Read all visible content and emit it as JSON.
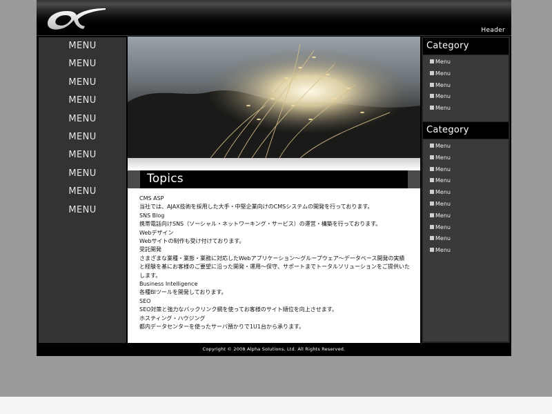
{
  "header": {
    "label": "Header"
  },
  "menu": {
    "items": [
      "MENU",
      "MENU",
      "MENU",
      "MENU",
      "MENU",
      "MENU",
      "MENU",
      "MENU",
      "MENU",
      "MENU"
    ]
  },
  "topics": {
    "title": "Topics",
    "entries": [
      {
        "heading": "CMS ASP",
        "text": "当社では、AJAX技術を採用した大手・中堅企業向けのCMSシステムの開発を行っております。"
      },
      {
        "heading": "SNS Blog",
        "text": "携帯電話向けSNS（ソーシャル・ネットワーキング・サービス）の運営・構築を行っております。"
      },
      {
        "heading": "Webデザイン",
        "text": "Webサイトの制作も受け付けております。"
      },
      {
        "heading": "受託開発",
        "text": "さまざまな業種・業態・業務に対応したWebアプリケーション～グループウェア～データベース開発の実績と経験を基にお客様のご要望に沿った開発・運用～保守、サポートまでトータルソリューションをご提供いたします。"
      },
      {
        "heading": "Business Intelligence",
        "text": "各種BIツールを開発しております。"
      },
      {
        "heading": "SEO",
        "text": "SEO対策と強力なバックリンク網を使ってお客様のサイト順位を向上させます。"
      },
      {
        "heading": "ホスティング・ハウジング",
        "text": "都内データセンターを使ったサーバ預かりで1U1台から承ります。"
      }
    ]
  },
  "categories": [
    {
      "title": "Category",
      "items": [
        "Menu",
        "Menu",
        "Menu",
        "Menu",
        "Menu"
      ]
    },
    {
      "title": "Category",
      "items": [
        "Menu",
        "Menu",
        "Menu",
        "Menu",
        "Menu",
        "Menu",
        "Menu",
        "Menu",
        "Menu",
        "Menu"
      ]
    }
  ],
  "footer": {
    "copyright": "Copyright © 2008 Alpha Solutions, Ltd. All Rights Reserved."
  }
}
